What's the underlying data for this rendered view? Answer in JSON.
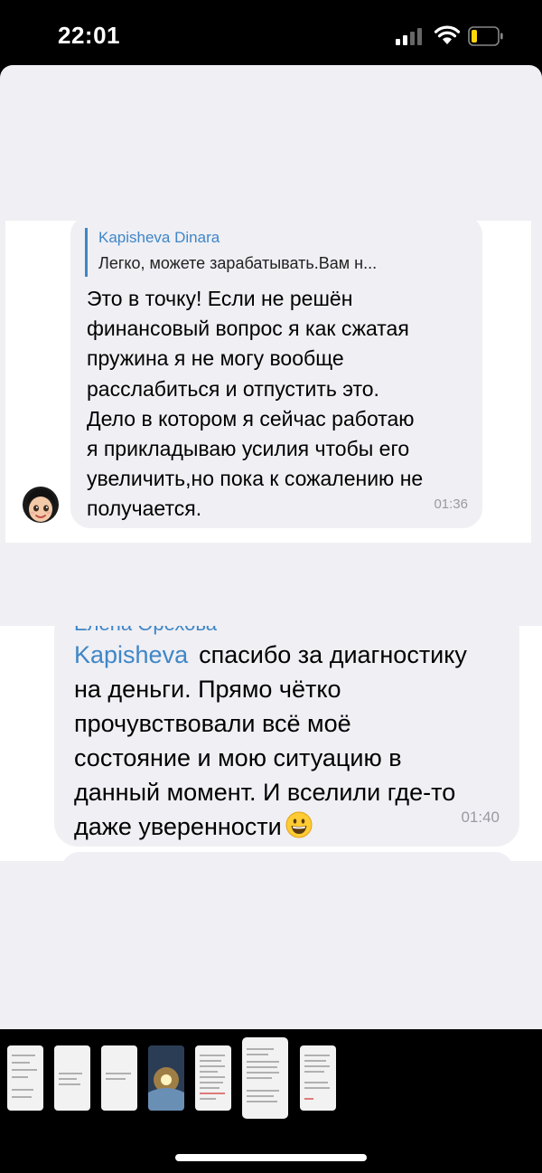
{
  "status": {
    "time": "22:01"
  },
  "screenshot1": {
    "reply_name": "Kapisheva Dinara",
    "reply_text": "Легко, можете зарабатывать.Вам н...",
    "lines": [
      "Это в точку! Если не решён",
      "финансовый вопрос я как сжатая",
      "пружина я не могу вообще",
      "расслабиться и отпустить это.",
      "Дело в котором я сейчас работаю",
      "я прикладываю усилия чтобы его",
      "увеличить,но пока к сожалению не",
      "получается."
    ],
    "time": "01:36"
  },
  "screenshot2": {
    "sender_partial": "Елена Орехова",
    "mention": "Kapisheva",
    "line1": "спасибо за диагностику",
    "lines": [
      "на деньги. Прямо чётко",
      "прочувствовали всё моё",
      "состояние и мою ситуацию в",
      "данный момент. И вселили где-то",
      "даже уверенности"
    ],
    "time": "01:40"
  },
  "colors": {
    "accent": "#3f86c7",
    "bubble": "#efeff4",
    "background": "#000000"
  },
  "icons": [
    "signal-icon",
    "wifi-icon",
    "battery-icon",
    "grinning-emoji-icon",
    "avatar-memoji-icon"
  ]
}
